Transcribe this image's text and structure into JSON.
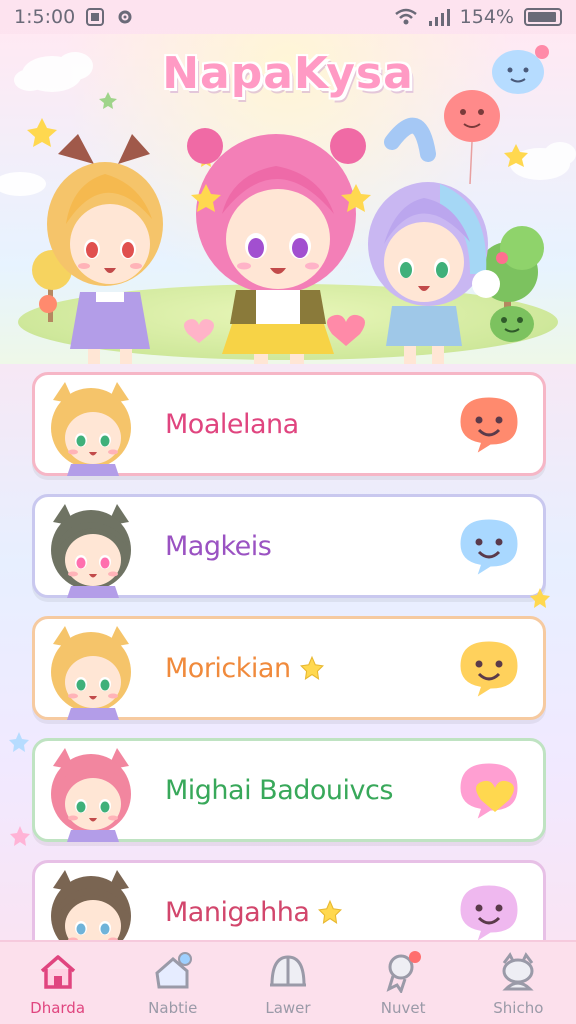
{
  "status_bar": {
    "time": "1:5:00",
    "battery": "154%"
  },
  "app": {
    "title": "NapaKysa"
  },
  "list": [
    {
      "name": "Moalelana",
      "star": false,
      "border": "#f6b6c6",
      "color": "#e0457f",
      "hair": "#f5c46a",
      "eyes": "#3fb07a",
      "chat_color": "#ff8a6e",
      "chat_icon": "smile-chat-icon"
    },
    {
      "name": "Magkeis",
      "star": false,
      "border": "#c9c8ef",
      "color": "#9a52c2",
      "hair": "#6f7363",
      "eyes": "#ff6fae",
      "chat_color": "#a9d8ff",
      "chat_icon": "smile-chat-icon"
    },
    {
      "name": "Morickian",
      "star": true,
      "border": "#f6caa0",
      "color": "#f08a3c",
      "hair": "#f5c46a",
      "eyes": "#3fb07a",
      "chat_color": "#ffd15c",
      "chat_icon": "smile-chat-icon"
    },
    {
      "name": "Mighai Badouivcs",
      "star": false,
      "border": "#bfe3c2",
      "color": "#38a85a",
      "hair": "#f2869f",
      "eyes": "#3fb07a",
      "chat_color": "#ff9fd2",
      "chat_icon": "heart-chat-icon"
    },
    {
      "name": "Manigahha",
      "star": true,
      "border": "#e7c0e6",
      "color": "#d2466c",
      "hair": "#7a6552",
      "eyes": "#6fb3d9",
      "chat_color": "#efb8ef",
      "chat_icon": "smile-chat-icon"
    }
  ],
  "bottom_nav": [
    {
      "label": "Dharda",
      "icon": "home-icon",
      "active": true
    },
    {
      "label": "Nabtie",
      "icon": "chat-icon",
      "active": false
    },
    {
      "label": "Lawer",
      "icon": "dome-icon",
      "active": false
    },
    {
      "label": "Nuvet",
      "icon": "badge-icon",
      "active": false
    },
    {
      "label": "Shicho",
      "icon": "character-icon",
      "active": false
    }
  ],
  "colors": {
    "accent": "#e0457f",
    "nav_bg": "#fce0ec"
  }
}
